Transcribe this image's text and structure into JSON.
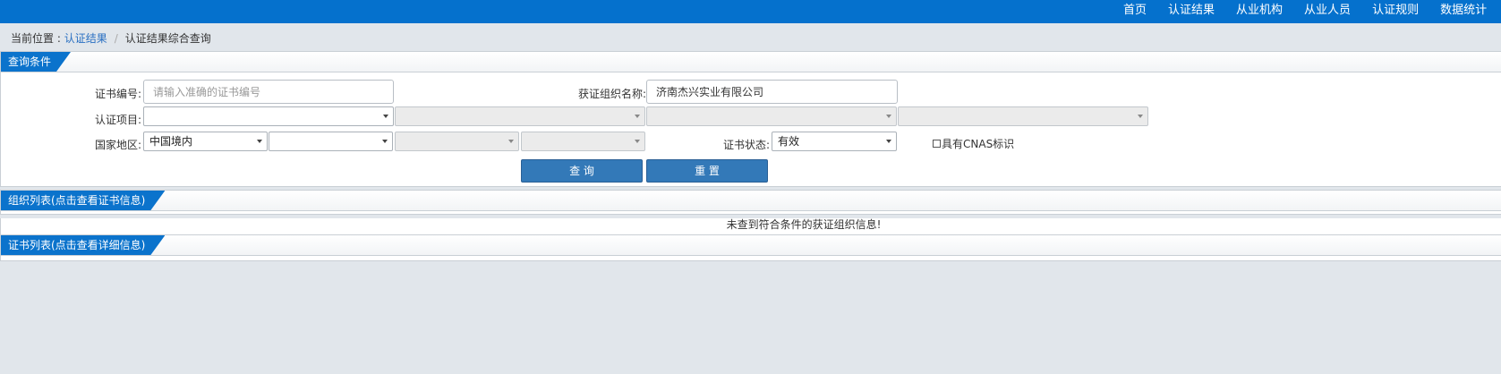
{
  "topnav": {
    "items": [
      "首页",
      "认证结果",
      "从业机构",
      "从业人员",
      "认证规则",
      "数据统计"
    ]
  },
  "breadcrumb": {
    "prefix": "当前位置 : ",
    "link": "认证结果",
    "separator": "/",
    "current": "认证结果综合查询"
  },
  "query": {
    "title": "查询条件",
    "cert_no_label": "证书编号:",
    "cert_no_placeholder": "请输入准确的证书编号",
    "cert_no_value": "",
    "org_name_label": "获证组织名称:",
    "org_name_value": "济南杰兴实业有限公司",
    "cert_project_label": "认证项目:",
    "cert_project_selects": [
      "",
      "",
      "",
      ""
    ],
    "region_label": "国家地区:",
    "region_selects": [
      "中国境内",
      "",
      "",
      ""
    ],
    "status_label": "证书状态:",
    "status_value": "有效",
    "cnas_label": "具有CNAS标识",
    "search_button": "查 询",
    "reset_button": "重 置"
  },
  "org_list": {
    "title": "组织列表(点击查看证书信息)",
    "empty_message": "未查到符合条件的获证组织信息!"
  },
  "cert_list": {
    "title": "证书列表(点击查看详细信息)"
  },
  "colors": {
    "topbar": "#0571cd",
    "tab": "#0b73cc",
    "button": "#3379b8",
    "page_bg": "#e1e6eb"
  }
}
